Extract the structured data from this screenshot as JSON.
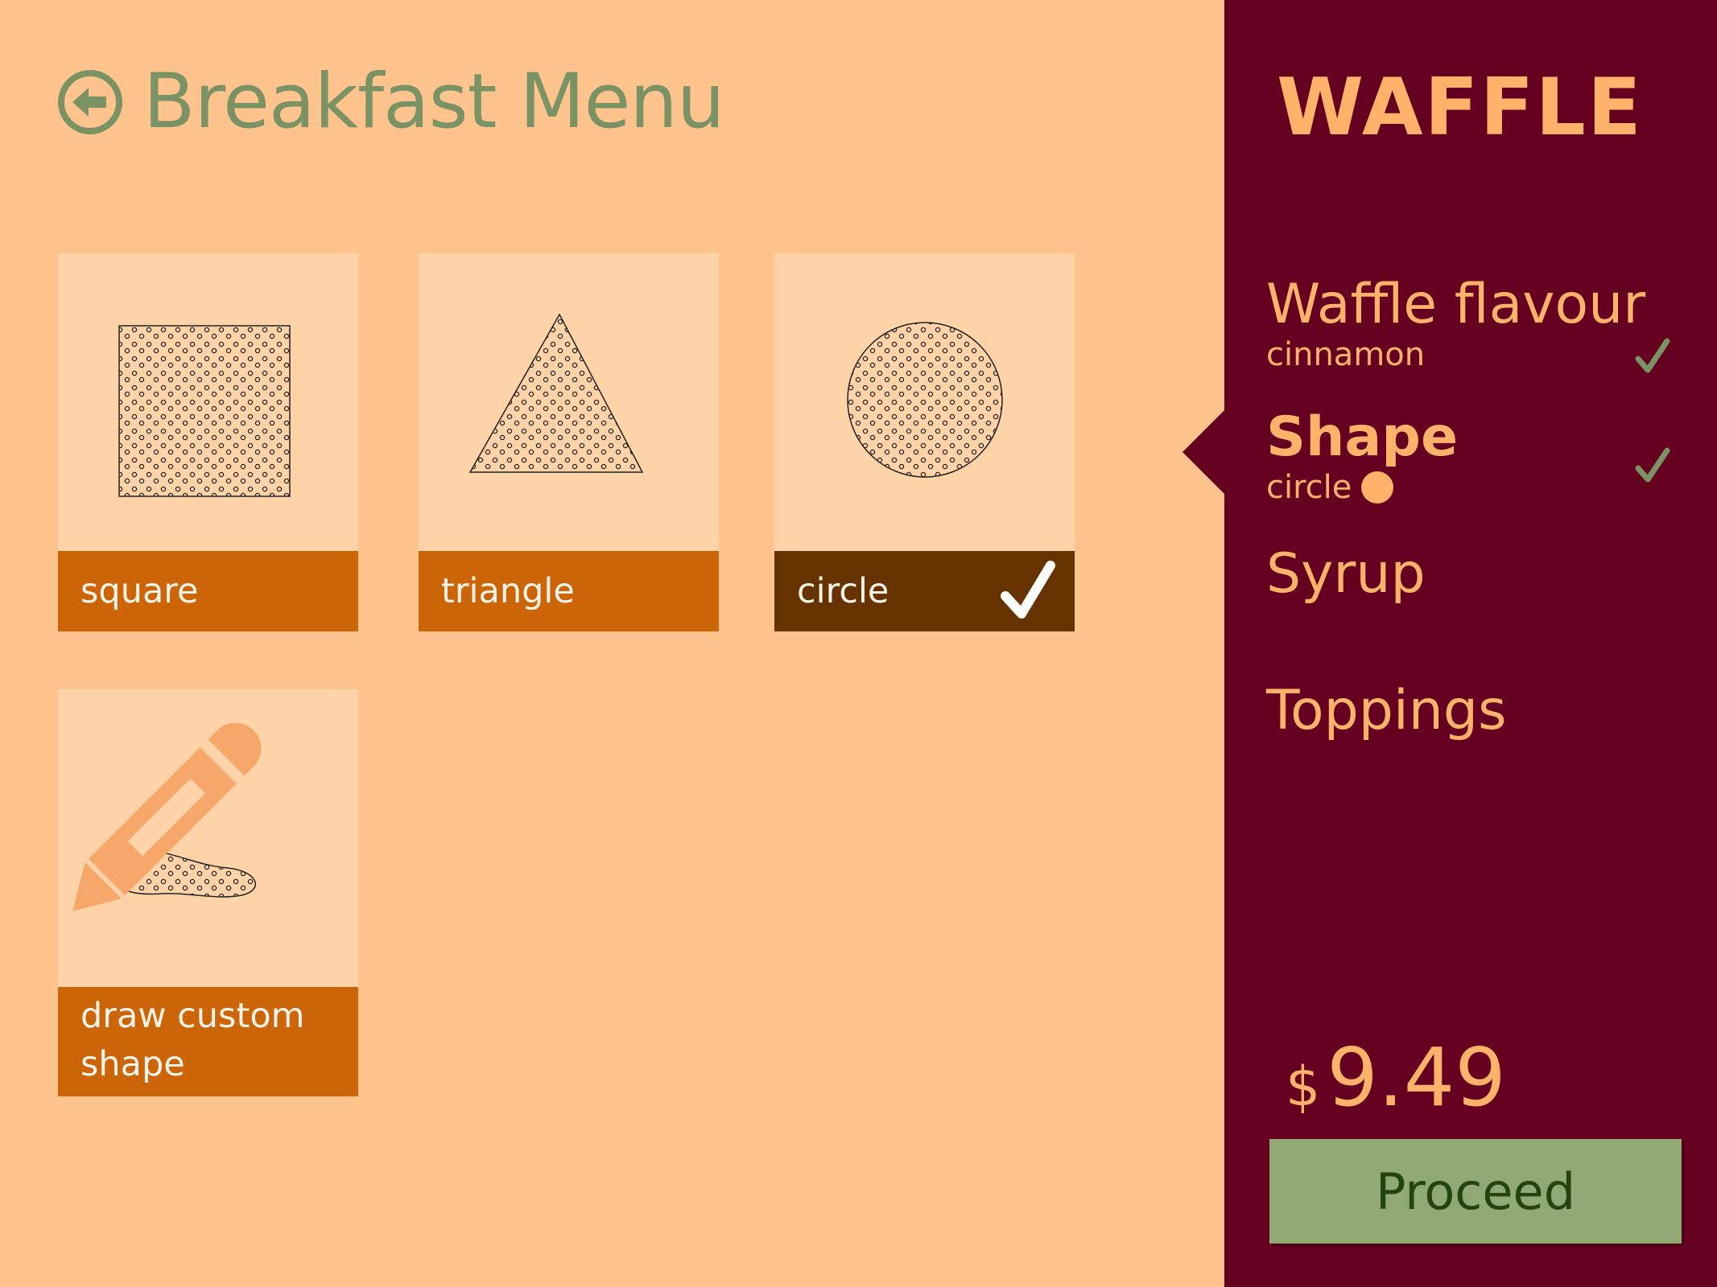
{
  "header": {
    "title": "Breakfast Menu"
  },
  "options": [
    {
      "label": "square",
      "selected": false
    },
    {
      "label": "triangle",
      "selected": false
    },
    {
      "label": "circle",
      "selected": true
    },
    {
      "label": "draw custom shape",
      "selected": false
    }
  ],
  "sidebar": {
    "product": "WAFFLE",
    "steps": [
      {
        "title": "Waffle flavour",
        "value": "cinnamon",
        "done": true
      },
      {
        "title": "Shape",
        "value": "circle",
        "done": true,
        "active": true
      },
      {
        "title": "Syrup",
        "value": "",
        "done": false
      },
      {
        "title": "Toppings",
        "value": "",
        "done": false
      }
    ],
    "price": {
      "currency": "$",
      "amount": "9.49"
    },
    "proceed_label": "Proceed"
  },
  "colors": {
    "background": "#FFC48E",
    "tile": "#FFD3A8",
    "label": "#CC6508",
    "label_selected": "#663300",
    "sidebar": "#660020",
    "accent": "#FFB36A",
    "green": "#7A9264",
    "button": "#8FA874"
  },
  "icons": [
    "back-arrow-icon",
    "pencil-icon",
    "checkmark-icon"
  ]
}
